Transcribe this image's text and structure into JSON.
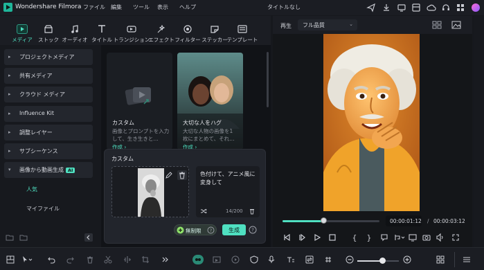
{
  "app": {
    "name": "Wondershare Filmora",
    "document_title": "タイトルなし"
  },
  "menu": [
    "ファイル",
    "編集",
    "ツール",
    "表示",
    "ヘルプ"
  ],
  "titlebar_icons": [
    "send-icon",
    "download-icon",
    "monitor-icon",
    "layout-icon",
    "gift-icon",
    "cloud-icon",
    "headset-icon",
    "grid-icon",
    "avatar-icon"
  ],
  "library_tabs": [
    {
      "label": "メディア",
      "icon": "media-icon",
      "active": true
    },
    {
      "label": "ストック",
      "icon": "stock-icon"
    },
    {
      "label": "オーディオ",
      "icon": "audio-icon"
    },
    {
      "label": "タイトル",
      "icon": "title-icon"
    },
    {
      "label": "トランジション",
      "icon": "transition-icon"
    },
    {
      "label": "エフェクト",
      "icon": "effect-icon"
    },
    {
      "label": "フィルター",
      "icon": "filter-icon"
    },
    {
      "label": "ステッカー",
      "icon": "sticker-icon"
    },
    {
      "label": "テンプレート",
      "icon": "template-icon"
    }
  ],
  "sidebar": {
    "items": [
      {
        "label": "プロジェクトメディア"
      },
      {
        "label": "共有メディア"
      },
      {
        "label": "クラウド メディア"
      },
      {
        "label": "Influence Kit"
      },
      {
        "label": "調整レイヤー"
      },
      {
        "label": "サブシーケンス"
      },
      {
        "label": "画像から動画生成",
        "badge": "AI",
        "expanded": true
      }
    ],
    "subitems": [
      {
        "label": "人気",
        "active": true
      },
      {
        "label": "マイファイル"
      }
    ]
  },
  "cards": [
    {
      "title": "カスタム",
      "desc": [
        "画像とプロンプトを入力",
        "して、生き生きと…"
      ],
      "link": "作成 ›"
    },
    {
      "title": "大切な人をハグ",
      "desc": [
        "大切な人物の画像を1",
        "枚にまとめて、それ…"
      ],
      "link": "作成 ›"
    }
  ],
  "custom_panel": {
    "title": "カスタム",
    "prompt": "色付けて、アニメ風に変身して",
    "char_count": "14/200",
    "unlimited_label": "無制限",
    "generate_label": "生成"
  },
  "preview": {
    "play_label": "再生",
    "quality": "フル品質",
    "timecode_current": "00:00:01:12",
    "timecode_separator": "/",
    "timecode_total": "00:00:03:12",
    "progress": 0.42
  },
  "bottom_toolbar": {
    "zoom_level": 0.6
  },
  "colors": {
    "accent": "#4fe0c1",
    "background": "#16181d",
    "panel": "#22252c"
  }
}
